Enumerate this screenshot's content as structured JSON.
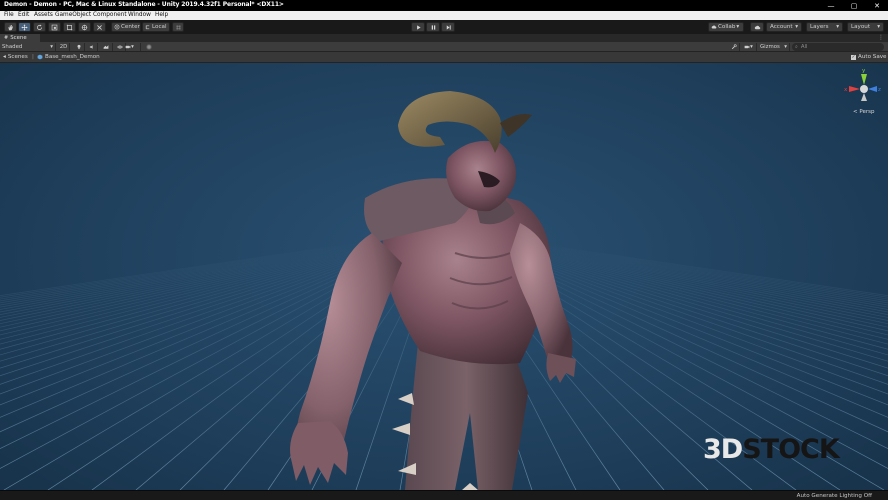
{
  "window": {
    "title": "Demon - Demon - PC, Mac & Linux Standalone - Unity 2019.4.32f1 Personal* <DX11>",
    "controls": {
      "minimize": "—",
      "maximize": "▢",
      "close": "✕"
    }
  },
  "menu": [
    "File",
    "Edit",
    "Assets",
    "GameObject",
    "Component",
    "Window",
    "Help"
  ],
  "toolbar": {
    "pivot_label": "Center",
    "space_label": "Local",
    "collab_label": "Collab",
    "account_label": "Account",
    "layers_label": "Layers",
    "layout_label": "Layout"
  },
  "scene_tab": {
    "label": "Scene"
  },
  "scene_toolbar": {
    "shading_mode": "Shaded",
    "mode_2d": "2D",
    "gizmos_label": "Gizmos",
    "search_placeholder": "All"
  },
  "breadcrumb": {
    "root": "Scenes",
    "object": "Base_mesh_Demon",
    "auto_save_label": "Auto Save"
  },
  "orientation_gizmo": {
    "y": "y",
    "x": "x",
    "z": "z",
    "perspective_label": "< Persp"
  },
  "watermark": {
    "part1": "3D",
    "part2": "STOCK"
  },
  "status_bar": {
    "text": "Auto Generate Lighting Off"
  },
  "colors": {
    "viewport_bg": "#22466a",
    "grid": "#5f84a3",
    "selected_tool": "#46607c",
    "gizmo_x": "#e04040",
    "gizmo_y": "#8bd13b",
    "gizmo_z": "#3f7fe0"
  }
}
